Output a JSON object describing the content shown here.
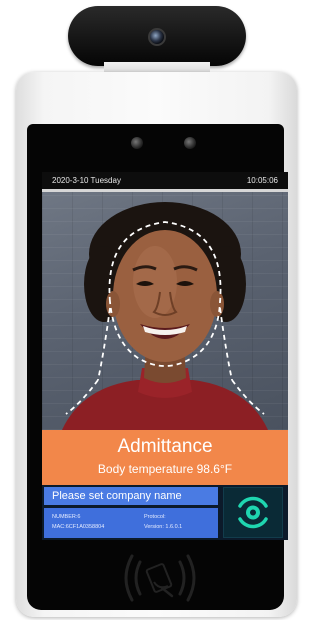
{
  "status_bar": {
    "date": "2020-3-10  Tuesday",
    "time": "10:05:06"
  },
  "banner": {
    "title": "Admittance",
    "temperature": "Body temperature 98.6°F"
  },
  "company": {
    "name": "Please set company name"
  },
  "device_info": {
    "number": "NUMBER:6",
    "mac": "MAC:6CF1A0358804",
    "protocol": "Protocol:",
    "version": "Version: 1.6.0.1"
  },
  "colors": {
    "banner": "#f2874a",
    "info_panel": "#4a7be3",
    "recognize_icon": "#1fd6b0"
  },
  "icons": [
    "camera-lens-icon",
    "face-outline-icon",
    "face-recognition-icon",
    "nfc-card-icon"
  ]
}
